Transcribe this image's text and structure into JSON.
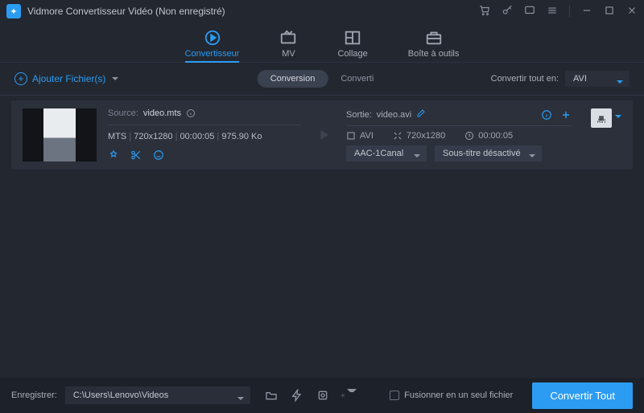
{
  "titlebar": {
    "app_name": "Vidmore Convertisseur Vidéo (Non enregistré)"
  },
  "tabs": {
    "converter": "Convertisseur",
    "mv": "MV",
    "collage": "Collage",
    "toolbox": "Boîte à outils"
  },
  "subbar": {
    "add_files": "Ajouter Fichier(s)",
    "mini_conversion": "Conversion",
    "mini_converted": "Converti",
    "convert_all_in": "Convertir tout en:",
    "format": "AVI"
  },
  "file": {
    "source_label": "Source:",
    "source_name": "video.mts",
    "format": "MTS",
    "resolution": "720x1280",
    "duration": "00:00:05",
    "size": "975.90 Ko",
    "output_label": "Sortie:",
    "output_name": "video.avi",
    "out_format": "AVI",
    "out_resolution": "720x1280",
    "out_duration": "00:00:05",
    "audio": "AAC-1Canal",
    "subtitle": "Sous-titre désactivé",
    "chip": "AVI"
  },
  "bottom": {
    "save_label": "Enregistrer:",
    "path": "C:\\Users\\Lenovo\\Videos",
    "merge": "Fusionner en un seul fichier",
    "convert_all": "Convertir Tout"
  }
}
